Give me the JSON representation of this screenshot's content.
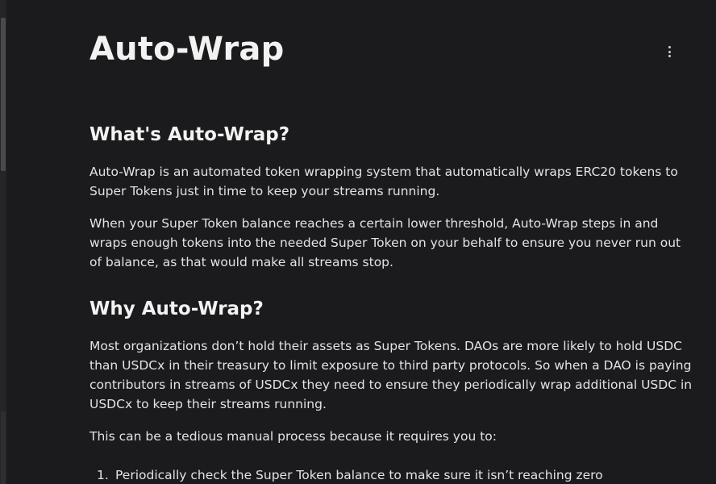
{
  "page": {
    "title": "Auto-Wrap"
  },
  "sections": [
    {
      "heading": "What's Auto-Wrap?",
      "paragraphs": [
        "Auto-Wrap is an automated token wrapping system that automatically wraps ERC20 tokens to Super Tokens just in time to keep your streams running.",
        "When your Super Token balance reaches a certain lower threshold, Auto-Wrap steps in and wraps enough tokens into the needed Super Token on your behalf to ensure you never run out of balance, as that would make all streams stop."
      ]
    },
    {
      "heading": "Why Auto-Wrap?",
      "paragraphs": [
        "Most organizations don’t hold their assets as Super Tokens. DAOs are more likely to hold USDC than USDCx in their treasury to limit exposure to third party protocols. So when a DAO is paying contributors in streams of USDCx they need to ensure they periodically wrap additional USDC in USDCx to keep their streams running.",
        "This can be a tedious manual process because it requires you to:"
      ],
      "list": [
        {
          "number": "1.",
          "text": "Periodically check the Super Token balance to make sure it isn’t reaching zero"
        }
      ]
    }
  ]
}
